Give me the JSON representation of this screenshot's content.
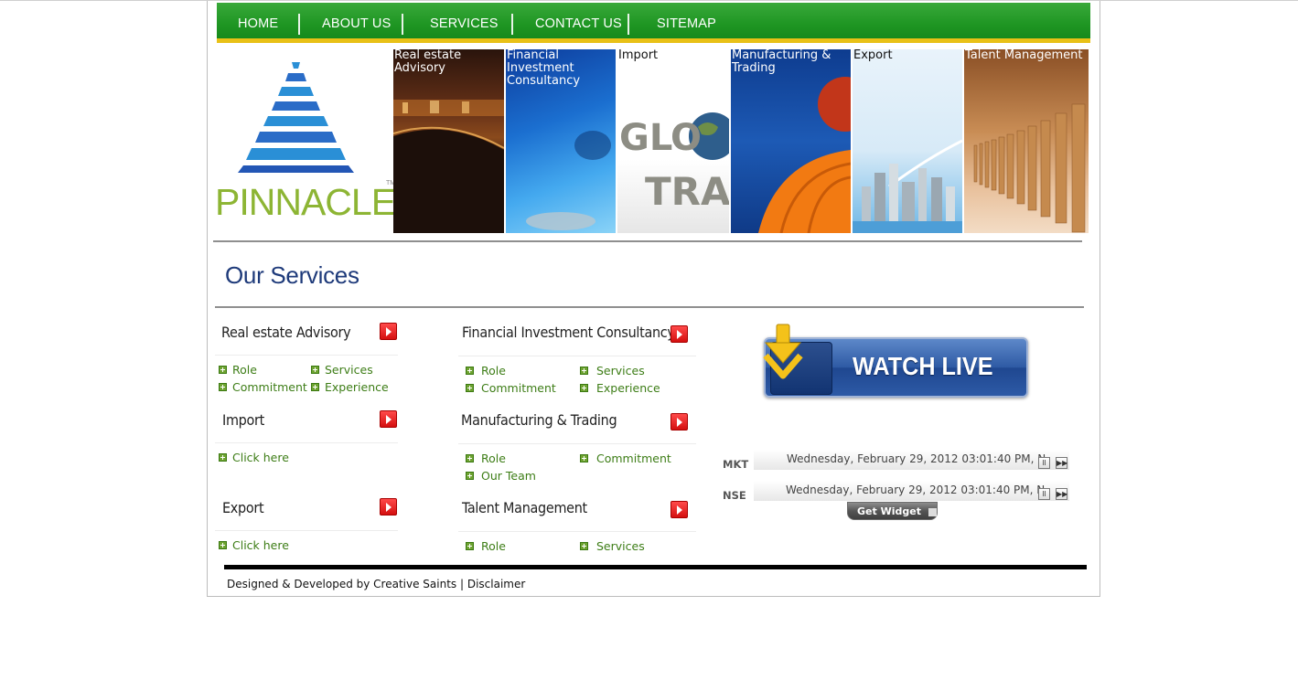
{
  "nav": {
    "items": [
      "HOME",
      "ABOUT US",
      "SERVICES",
      "CONTACT US",
      "SITEMAP"
    ]
  },
  "logo": {
    "text": "PINNACLE",
    "tm": "TM"
  },
  "banner": {
    "tiles": [
      {
        "label": "Real estate\nAdvisory",
        "label_color": "#ffffff"
      },
      {
        "label": "Financial\nInvestment\nConsultancy",
        "label_color": "#ffffff"
      },
      {
        "label": "Import",
        "label_color": "#111111",
        "image_text": "GLO\nTRA"
      },
      {
        "label": "Manufacturing &\nTrading",
        "label_color": "#ffffff"
      },
      {
        "label": "Export",
        "label_color": "#111111"
      },
      {
        "label": "Talent Management",
        "label_color": "#ffffff"
      }
    ]
  },
  "services": {
    "title": "Our Services",
    "blocks": [
      {
        "title": "Real estate Advisory",
        "links": [
          "Role",
          "Services",
          "Commitment",
          "Experience"
        ]
      },
      {
        "title": "Financial Investment Consultancy",
        "links": [
          "Role",
          "Services",
          "Commitment",
          "Experience"
        ]
      },
      {
        "title": "Import",
        "links": [
          "Click here"
        ]
      },
      {
        "title": "Manufacturing & Trading",
        "links": [
          "Role",
          "Commitment",
          "Our Team"
        ]
      },
      {
        "title": "Export",
        "links": [
          "Click here"
        ]
      },
      {
        "title": "Talent Management",
        "links": [
          "Role",
          "Services"
        ]
      }
    ]
  },
  "watch_live": {
    "label": "WATCH LIVE"
  },
  "tickers": [
    {
      "label": "MKT",
      "text": "Wednesday, February 29, 2012 03:01:40 PM, N"
    },
    {
      "label": "NSE",
      "text": "Wednesday, February 29, 2012 03:01:40 PM, N"
    }
  ],
  "ticker_controls": {
    "pause": "II",
    "forward": "▶▶"
  },
  "get_widget": {
    "label": "Get Widget"
  },
  "footer": {
    "text": "Designed & Developed by Creative Saints | Disclaimer"
  },
  "colors": {
    "nav_green": "#1f9623",
    "nav_yellow": "#e8c117",
    "title_blue": "#1e3a7a",
    "link_green": "#3d7d16",
    "logo_green": "#8db534",
    "arrow_red": "#d40f0f"
  }
}
